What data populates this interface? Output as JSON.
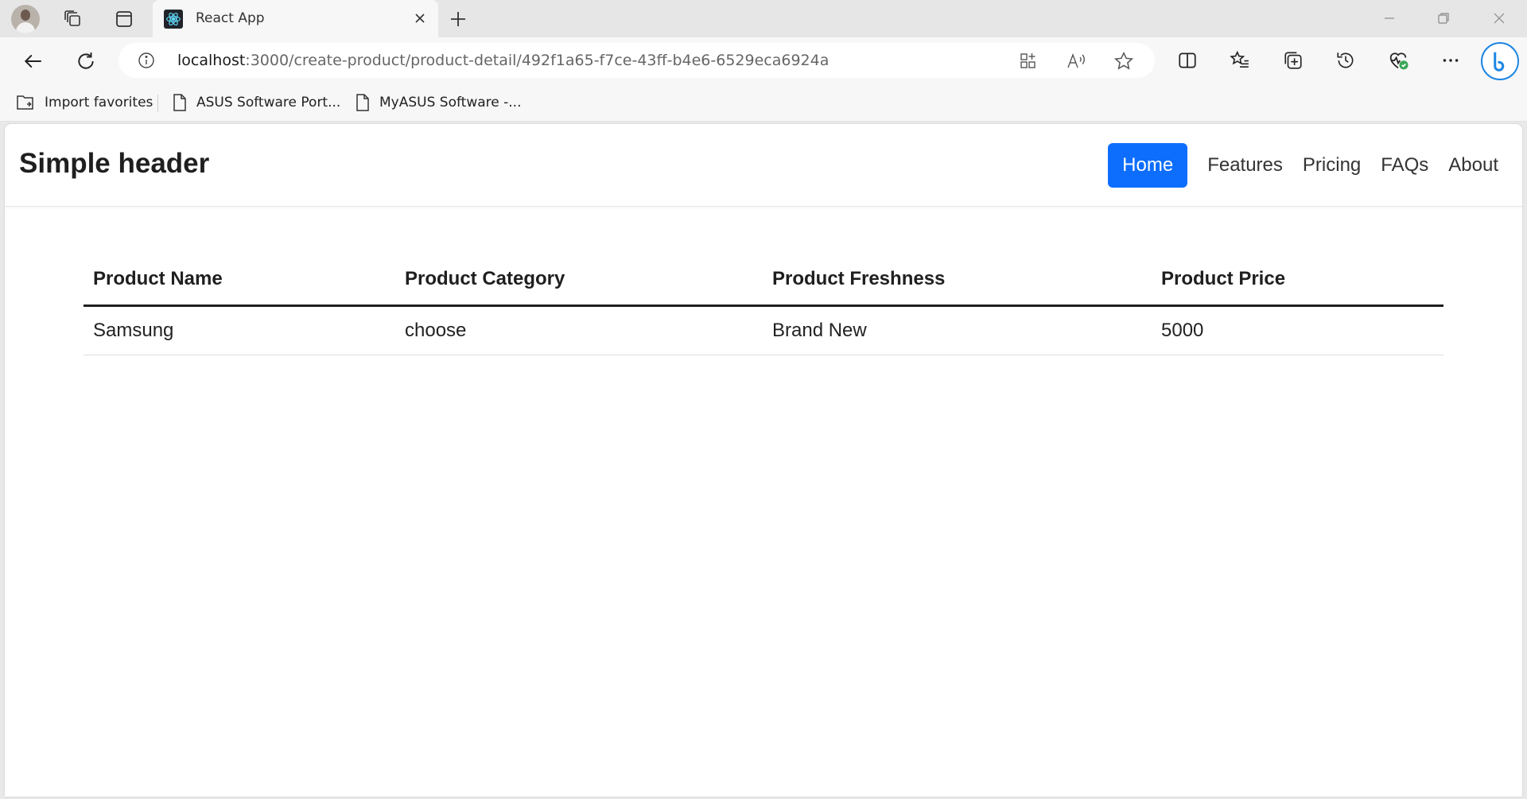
{
  "browser": {
    "tab_title": "React App",
    "url_host": "localhost",
    "url_path": ":3000/create-product/product-detail/492f1a65-f7ce-43ff-b4e6-6529eca6924a",
    "bookmarks": [
      {
        "label": "Import favorites",
        "icon": "import-folder-icon"
      },
      {
        "label": "ASUS Software Port...",
        "icon": "page-icon"
      },
      {
        "label": "MyASUS Software -...",
        "icon": "page-icon"
      }
    ]
  },
  "site": {
    "brand": "Simple header",
    "nav": [
      "Home",
      "Features",
      "Pricing",
      "FAQs",
      "About"
    ],
    "accent_color": "#0d6efd"
  },
  "table": {
    "headers": [
      "Product Name",
      "Product Category",
      "Product Freshness",
      "Product Price"
    ],
    "rows": [
      [
        "Samsung",
        "choose",
        "Brand New",
        "5000"
      ]
    ]
  }
}
